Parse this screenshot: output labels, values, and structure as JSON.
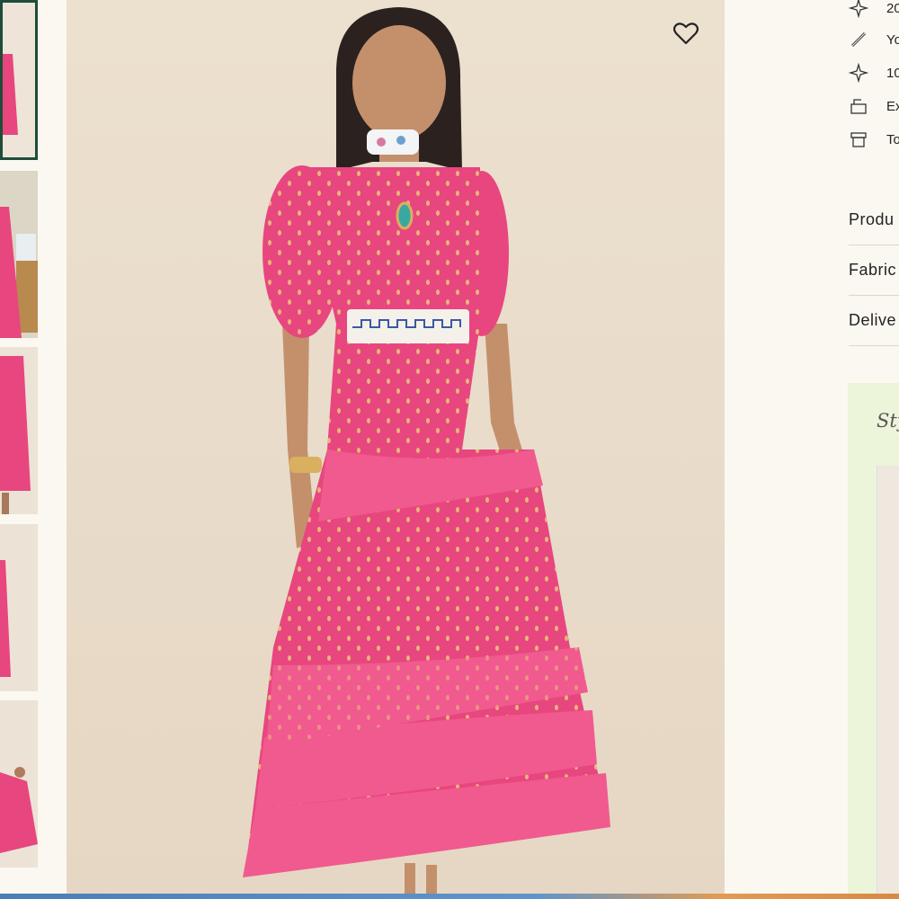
{
  "thumbnails": [
    {
      "label": "",
      "active": true
    },
    {
      "label": "",
      "active": false
    },
    {
      "label": "",
      "active": false
    },
    {
      "label": "",
      "active": false
    },
    {
      "label": "",
      "active": false
    }
  ],
  "main_image": {
    "alt": "",
    "wishlist_icon": "heart-outline-icon"
  },
  "features": [
    {
      "icon": "sparkle-icon",
      "text": "20"
    },
    {
      "icon": "ruler-icon",
      "text": "Yo"
    },
    {
      "icon": "sparkle-icon",
      "text": "10"
    },
    {
      "icon": "return-box-icon",
      "text": "Ex"
    },
    {
      "icon": "shop-icon",
      "text": "To"
    }
  ],
  "accordion": [
    {
      "label": "Produ"
    },
    {
      "label": "Fabric"
    },
    {
      "label": "Delive"
    }
  ],
  "style_section": {
    "title": "Sty"
  },
  "colors": {
    "accent": "#1f4d3a",
    "dress": "#e8467f",
    "style_bg": "#ecf5d9"
  }
}
